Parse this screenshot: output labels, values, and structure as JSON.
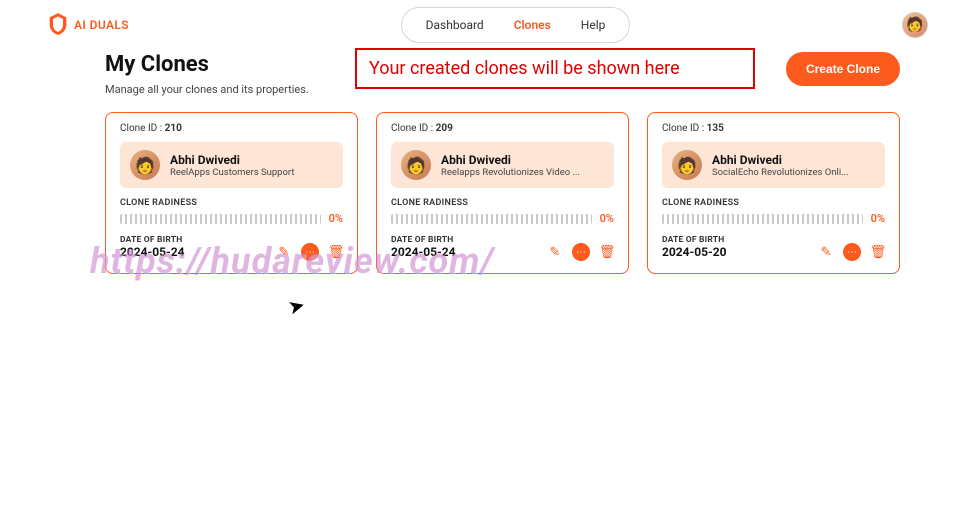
{
  "brand": {
    "name": "AI DUALS"
  },
  "nav": {
    "items": [
      {
        "label": "Dashboard",
        "active": false
      },
      {
        "label": "Clones",
        "active": true
      },
      {
        "label": "Help",
        "active": false
      }
    ]
  },
  "page": {
    "title": "My Clones",
    "subtitle": "Manage all your clones and its properties.",
    "create_label": "Create Clone"
  },
  "annotation": {
    "text": "Your created clones will be shown here"
  },
  "labels": {
    "clone_id_prefix": "Clone ID :",
    "readiness": "CLONE RADINESS",
    "dob": "DATE OF BIRTH"
  },
  "clones": [
    {
      "id": "210",
      "owner_name": "Abhi Dwivedi",
      "owner_role": "ReelApps Customers Support",
      "readiness_pct": "0%",
      "dob": "2024-05-24"
    },
    {
      "id": "209",
      "owner_name": "Abhi Dwivedi",
      "owner_role": "Reelapps Revolutionizes Video ...",
      "readiness_pct": "0%",
      "dob": "2024-05-24"
    },
    {
      "id": "135",
      "owner_name": "Abhi Dwivedi",
      "owner_role": "SocialEcho Revolutionizes Onli...",
      "readiness_pct": "0%",
      "dob": "2024-05-20"
    }
  ],
  "watermark": "https://hudareview.com/"
}
